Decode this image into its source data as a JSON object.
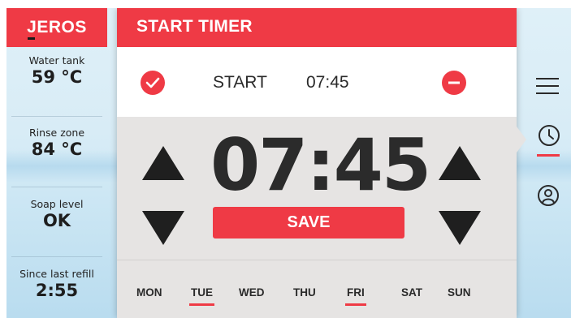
{
  "sidebar": {
    "brand": "JEROS",
    "stats": [
      {
        "label": "Water tank",
        "value": "59 °C"
      },
      {
        "label": "Rinse zone",
        "value": "84 °C"
      },
      {
        "label": "Soap level",
        "value": "OK"
      },
      {
        "label": "Since last refill",
        "value": "2:55"
      }
    ]
  },
  "panel": {
    "title": "START TIMER",
    "start_label": "START",
    "start_time": "07:45",
    "big_time": "07:45",
    "save_label": "SAVE",
    "days": [
      {
        "label": "MON",
        "selected": false
      },
      {
        "label": "TUE",
        "selected": true
      },
      {
        "label": "WED",
        "selected": false
      },
      {
        "label": "THU",
        "selected": false
      },
      {
        "label": "FRI",
        "selected": true
      },
      {
        "label": "SAT",
        "selected": false
      },
      {
        "label": "SUN",
        "selected": false
      }
    ]
  },
  "nav": {
    "items": [
      {
        "icon": "menu-icon",
        "active": false
      },
      {
        "icon": "clock-icon",
        "active": true
      },
      {
        "icon": "user-icon",
        "active": false
      }
    ]
  },
  "colors": {
    "accent": "#ef3a45",
    "panel_gray": "#e6e4e3",
    "text_dark": "#2a2a2a"
  }
}
